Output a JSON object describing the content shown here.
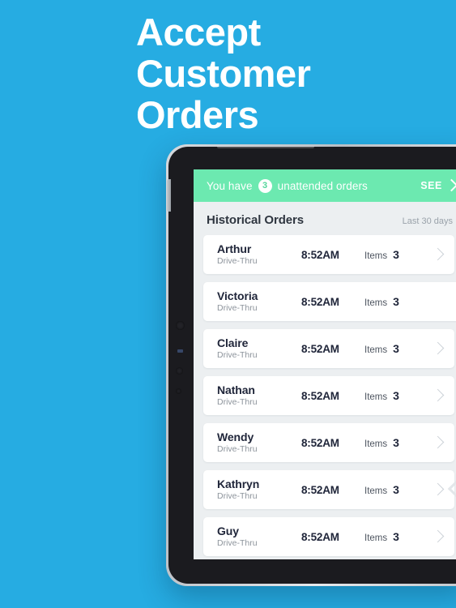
{
  "promo": {
    "background_color": "#26ace2",
    "heading_lines": [
      "Accept",
      "Customer",
      "Orders"
    ]
  },
  "app": {
    "banner": {
      "prefix_text": "You have",
      "count": "3",
      "suffix_text": "unattended orders",
      "action_label": "SEE",
      "action_icon": "chevron-right-icon",
      "background_color": "#6ce9b0"
    },
    "list_header": {
      "title": "Historical Orders",
      "range_label": "Last 30 days"
    },
    "columns": {
      "items_label": "Items"
    },
    "orders": [
      {
        "name": "Arthur",
        "channel": "Drive-Thru",
        "time": "8:52AM",
        "items_label": "Items",
        "items": "3"
      },
      {
        "name": "Victoria",
        "channel": "Drive-Thru",
        "time": "8:52AM",
        "items_label": "Items",
        "items": "3"
      },
      {
        "name": "Claire",
        "channel": "Drive-Thru",
        "time": "8:52AM",
        "items_label": "Items",
        "items": "3"
      },
      {
        "name": "Nathan",
        "channel": "Drive-Thru",
        "time": "8:52AM",
        "items_label": "Items",
        "items": "3"
      },
      {
        "name": "Wendy",
        "channel": "Drive-Thru",
        "time": "8:52AM",
        "items_label": "Items",
        "items": "3"
      },
      {
        "name": "Kathryn",
        "channel": "Drive-Thru",
        "time": "8:52AM",
        "items_label": "Items",
        "items": "3"
      },
      {
        "name": "Guy",
        "channel": "Drive-Thru",
        "time": "8:52AM",
        "items_label": "Items",
        "items": "3"
      }
    ]
  }
}
